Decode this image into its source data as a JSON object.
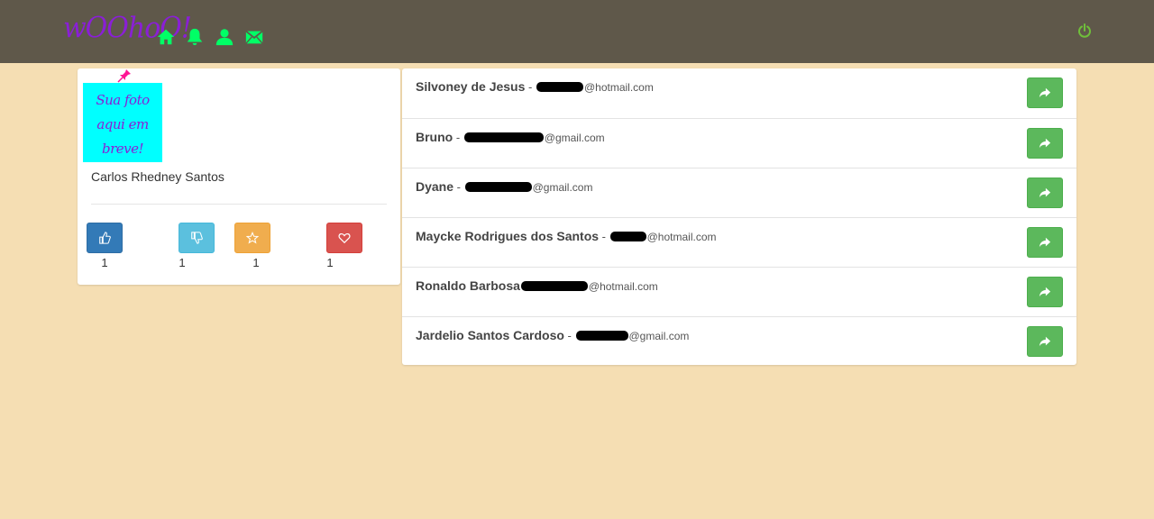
{
  "header": {
    "logo_text": "wOOhoO!",
    "nav": [
      {
        "name": "home-icon"
      },
      {
        "name": "bell-icon"
      },
      {
        "name": "user-icon"
      },
      {
        "name": "mail-icon"
      }
    ],
    "power_icon": "power-icon",
    "colors": {
      "bar": "#5f584a",
      "icon": "#00ff66",
      "logo": "#8a1fd6",
      "power": "#6fbf3a"
    }
  },
  "profile": {
    "photo_placeholder": "Sua foto aqui em breve!",
    "name": "Carlos Rhedney Santos",
    "ratings": [
      {
        "name": "thumbs-up-icon",
        "count": "1",
        "color": "#337ab7"
      },
      {
        "name": "thumbs-down-icon",
        "count": "1",
        "color": "#5bc0de"
      },
      {
        "name": "star-icon",
        "count": "1",
        "color": "#f0ad4e"
      },
      {
        "name": "heart-icon",
        "count": "1",
        "color": "#d9534f"
      }
    ]
  },
  "contacts": [
    {
      "name": "Silvoney de Jesus",
      "separator": " - ",
      "domain": "@hotmail.com"
    },
    {
      "name": "Bruno",
      "separator": " - ",
      "domain": "@gmail.com"
    },
    {
      "name": "Dyane",
      "separator": " - ",
      "domain": "@gmail.com"
    },
    {
      "name": "Maycke Rodrigues dos Santos",
      "separator": " - ",
      "domain": "@hotmail.com"
    },
    {
      "name": "Ronaldo Barbosa",
      "separator": "",
      "domain": "@hotmail.com"
    },
    {
      "name": "Jardelio Santos Cardoso",
      "separator": " - ",
      "domain": "@gmail.com"
    }
  ],
  "share_icon": "share-icon"
}
